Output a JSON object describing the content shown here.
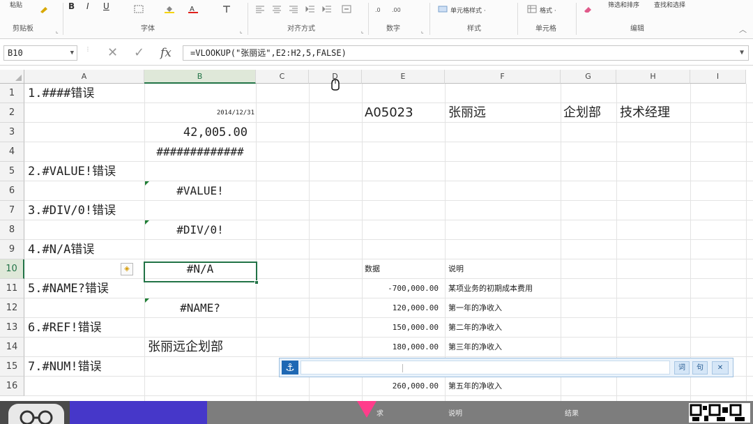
{
  "ribbon": {
    "top_labels": [
      "粘贴",
      "筛选和排序",
      "查找和选择"
    ],
    "bold": "B",
    "italic": "I",
    "underline": "U",
    "styles": {
      "conditional": "单元格样式 ·",
      "format": "格式 ·"
    },
    "groups": {
      "clipboard": "剪贴板",
      "font": "字体",
      "alignment": "对齐方式",
      "number": "数字",
      "styles": "样式",
      "cells": "单元格",
      "editing": "编辑"
    }
  },
  "formula_bar": {
    "name_box": "B10",
    "cancel": "✕",
    "enter": "✓",
    "fx": "fx",
    "formula": "=VLOOKUP(\"张丽远\",E2:H2,5,FALSE)"
  },
  "columns": [
    "A",
    "B",
    "C",
    "D",
    "E",
    "F",
    "G",
    "H",
    "I"
  ],
  "rows": [
    "1",
    "2",
    "3",
    "4",
    "5",
    "6",
    "7",
    "8",
    "9",
    "10",
    "11",
    "12",
    "13",
    "14",
    "15",
    "16"
  ],
  "cells": {
    "A1": "1.####错误",
    "B2": "2014/12/31",
    "B3": "42,005.00",
    "B4": "#############",
    "A5": "2.#VALUE!错误",
    "B6": "#VALUE!",
    "A7": "3.#DIV/0!错误",
    "B8": "#DIV/0!",
    "A9": "4.#N/A错误",
    "B10": "#N/A",
    "A11": "5.#NAME?错误",
    "B12": "#NAME?",
    "A13": "6.#REF!错误",
    "B14": "张丽远企划部",
    "A15": "7.#NUM!错误",
    "E2": "A05023",
    "F2": "张丽远",
    "G2": "企划部",
    "H2": "技术经理",
    "E10": "数据",
    "F10": "说明",
    "E11": "-700,000.00",
    "F11": "某项业务的初期成本费用",
    "E12": "120,000.00",
    "F12": "第一年的净收入",
    "E13": "150,000.00",
    "F13": "第二年的净收入",
    "E14": "180,000.00",
    "F14": "第三年的净收入",
    "E16": "260,000.00",
    "F16": "第五年的净收入"
  },
  "float_bar": {
    "logo": "⚓",
    "btn_prev": "词",
    "btn_next": "句",
    "btn_close": "✕"
  },
  "bottom": {
    "left_text": "求",
    "mid_text": "说明",
    "right_text": "结果"
  }
}
